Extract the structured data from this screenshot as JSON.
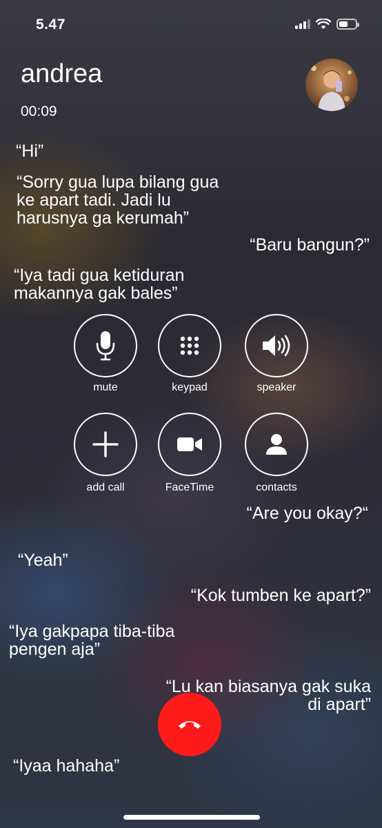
{
  "status_bar": {
    "time": "5.47",
    "battery_level": 0.55
  },
  "call": {
    "name": "andrea",
    "duration": "00:09"
  },
  "messages": [
    "“Hi”",
    "“Sorry gua lupa bilang gua\nke apart tadi. Jadi lu\nharusnya ga kerumah”",
    "“Baru bangun?”",
    "“Iya tadi gua ketiduran\nmakannya gak bales”",
    "“Are you okay?“",
    "“Yeah”",
    "“Kok tumben ke apart?”",
    "“Iya gakpapa tiba-tiba\npengen aja”",
    "“Lu kan biasanya gak suka\ndi apart”",
    "“Iyaa hahaha”"
  ],
  "controls": {
    "mute": "mute",
    "keypad": "keypad",
    "speaker": "speaker",
    "add_call": "add call",
    "facetime": "FaceTime",
    "contacts": "contacts"
  },
  "colors": {
    "end_call": "#ff1a1a",
    "foreground": "#ffffff"
  },
  "icons": [
    "microphone-icon",
    "keypad-icon",
    "speaker-icon",
    "plus-icon",
    "video-camera-icon",
    "person-icon",
    "end-call-icon",
    "signal-icon",
    "wifi-icon",
    "battery-icon"
  ]
}
